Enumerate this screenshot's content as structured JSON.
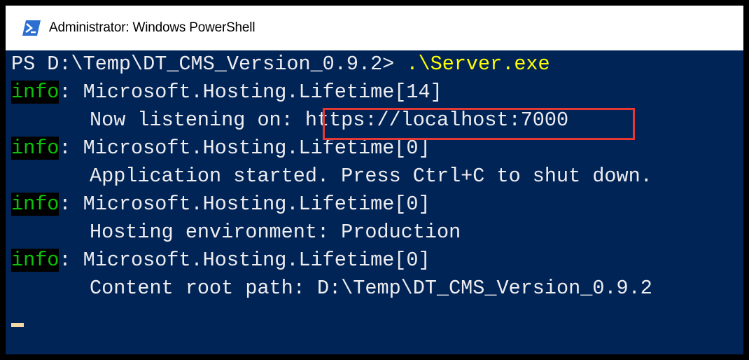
{
  "window": {
    "title": "Administrator: Windows PowerShell",
    "title_icon": "powershell-icon"
  },
  "console": {
    "prompt": "PS D:\\Temp\\DT_CMS_Version_0.9.2> ",
    "command": ".\\Server.exe",
    "info_tag": "info",
    "entries": [
      {
        "source": ": Microsoft.Hosting.Lifetime[14]",
        "message_label": "Now listening on: ",
        "message_value": "https://localhost:7000"
      },
      {
        "source": ": Microsoft.Hosting.Lifetime[0]",
        "message": "Application started. Press Ctrl+C to shut down."
      },
      {
        "source": ": Microsoft.Hosting.Lifetime[0]",
        "message": "Hosting environment: Production"
      },
      {
        "source": ": Microsoft.Hosting.Lifetime[0]",
        "message": "Content root path: D:\\Temp\\DT_CMS_Version_0.9.2"
      }
    ]
  },
  "colors": {
    "console_background": "#012456",
    "console_text": "#eeedf0",
    "command_text": "#ffff00",
    "info_text": "#0bc20b",
    "highlight_border": "#e53935",
    "cursor": "#f5d8a6"
  }
}
